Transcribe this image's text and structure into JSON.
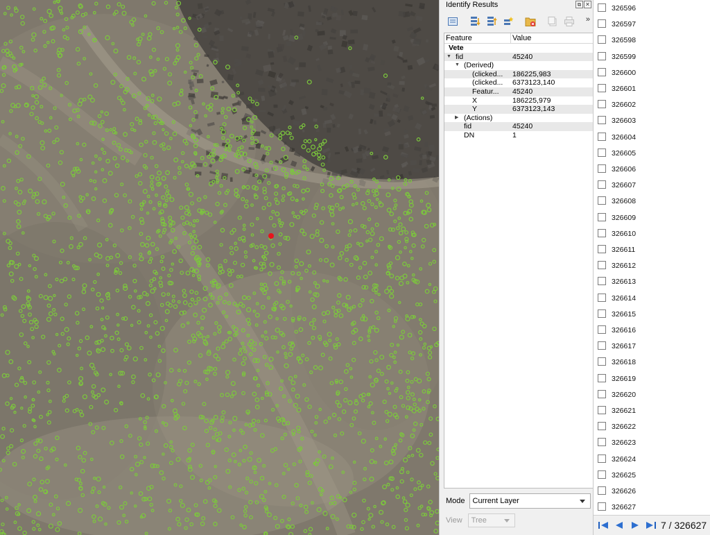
{
  "identify": {
    "title": "Identify Results",
    "float_glyph": "⧉",
    "close_glyph": "✕",
    "more_glyph": "»",
    "columns": {
      "feature": "Feature",
      "value": "Value"
    },
    "rows": [
      {
        "feature": "Vete",
        "value": "",
        "expanded": true
      },
      {
        "feature": "fid",
        "value": "45240",
        "expanded": true
      },
      {
        "feature": "(Derived)",
        "value": "",
        "expanded": true
      },
      {
        "feature": "(clicked...",
        "value": "186225,983"
      },
      {
        "feature": "(clicked...",
        "value": "6373123,140"
      },
      {
        "feature": "Featur...",
        "value": "45240"
      },
      {
        "feature": "X",
        "value": "186225,979"
      },
      {
        "feature": "Y",
        "value": "6373123,143"
      },
      {
        "feature": "(Actions)",
        "value": "",
        "expanded": false
      },
      {
        "feature": "fid",
        "value": "45240"
      },
      {
        "feature": "DN",
        "value": "1"
      }
    ],
    "mode_label": "Mode",
    "mode_value": "Current Layer",
    "view_label": "View",
    "view_value": "Tree",
    "toolbar_icons": [
      "expand-tree-icon",
      "expand-all-icon",
      "collapse-all-icon",
      "expand-new-icon",
      "clear-results-icon",
      "copy-feature-icon",
      "print-icon"
    ]
  },
  "list": {
    "items": [
      "326596",
      "326597",
      "326598",
      "326599",
      "326600",
      "326601",
      "326602",
      "326603",
      "326604",
      "326605",
      "326606",
      "326607",
      "326608",
      "326609",
      "326610",
      "326611",
      "326612",
      "326613",
      "326614",
      "326615",
      "326616",
      "326617",
      "326618",
      "326619",
      "326620",
      "326621",
      "326622",
      "326623",
      "326624",
      "326625",
      "326626",
      "326627"
    ]
  },
  "pager": {
    "text": "7 / 326627"
  },
  "colors": {
    "vegetation": "#7cc83c",
    "marker": "#e8141c",
    "ground": "#7f786c"
  }
}
